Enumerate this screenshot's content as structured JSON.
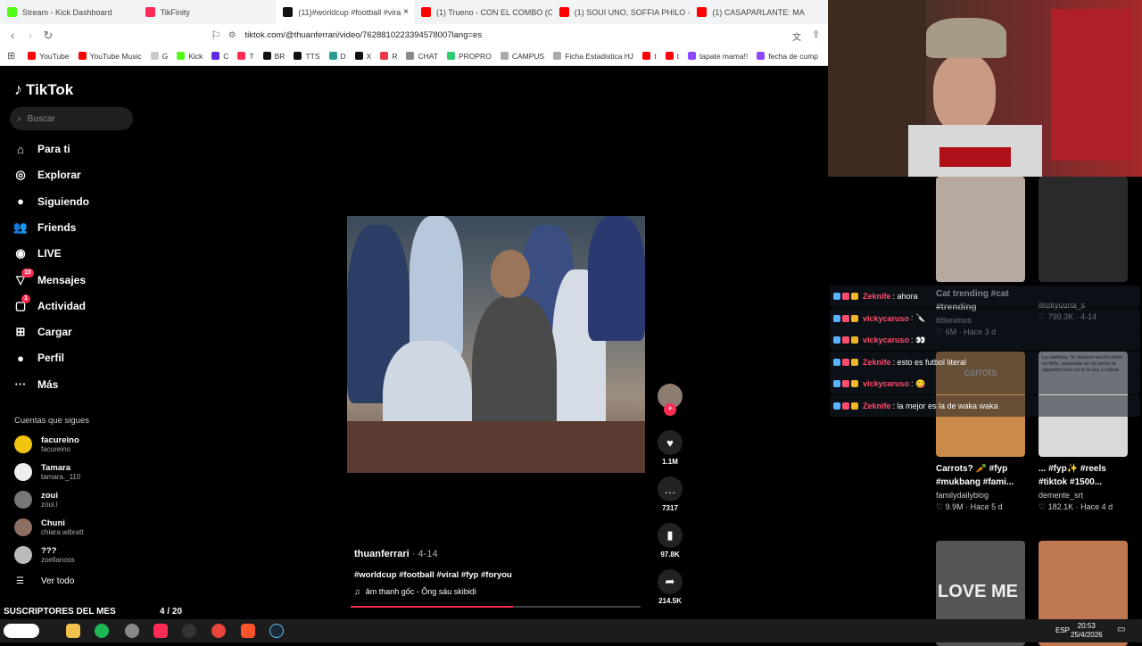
{
  "tabs": [
    {
      "label": "Stream - Kick Dashboard",
      "color": "#53fc18"
    },
    {
      "label": "TikFinity",
      "color": "#fe2c55"
    },
    {
      "label": "(11)#worldcup #football #vira",
      "color": "#111111",
      "active": true
    },
    {
      "label": "(1) Trueno - CON EL COMBO (Officia",
      "color": "#ff0000"
    },
    {
      "label": "(1) SOUI UNO, SOFFIA PHILO - NOS",
      "color": "#ff0000"
    },
    {
      "label": "(1) CASAPARLANTE: MA",
      "color": "#ff0000"
    }
  ],
  "address": {
    "url": "tiktok.com/@thuanferrari/video/7628810223394578007lang=es"
  },
  "bookmarks": [
    {
      "label": "YouTube",
      "color": "#ff0000"
    },
    {
      "label": "YouTube Music",
      "color": "#ff0000"
    },
    {
      "label": "G",
      "color": "#cccccc"
    },
    {
      "label": "Kick",
      "color": "#53fc18"
    },
    {
      "label": "C",
      "color": "#5b2ee0"
    },
    {
      "label": "T",
      "color": "#fe2c55"
    },
    {
      "label": "BR",
      "color": "#111111"
    },
    {
      "label": "TTS",
      "color": "#111111"
    },
    {
      "label": "D",
      "color": "#2a9d8f"
    },
    {
      "label": "X",
      "color": "#111111"
    },
    {
      "label": "R",
      "color": "#e63946"
    },
    {
      "label": "CHAT",
      "color": "#888888"
    },
    {
      "label": "PROPRO",
      "color": "#2ecc71"
    },
    {
      "label": "CAMPUS",
      "color": "#aaaaaa"
    },
    {
      "label": "Ficha Estadistica HJ",
      "color": "#aaaaaa"
    },
    {
      "label": "t",
      "color": "#ff0000"
    },
    {
      "label": "t",
      "color": "#ff0000"
    },
    {
      "label": "tapate mama!!",
      "color": "#9147ff"
    },
    {
      "label": "fecha de cump",
      "color": "#9147ff"
    }
  ],
  "tiktok": {
    "logo": "TikTok",
    "search_placeholder": "Buscar",
    "nav": [
      {
        "label": "Para ti",
        "icon": "⌂"
      },
      {
        "label": "Explorar",
        "icon": "◎"
      },
      {
        "label": "Siguiendo",
        "icon": "●"
      },
      {
        "label": "Friends",
        "icon": "👥"
      },
      {
        "label": "LIVE",
        "icon": "◉"
      },
      {
        "label": "Mensajes",
        "icon": "▽",
        "badge": "10"
      },
      {
        "label": "Actividad",
        "icon": "▢",
        "badge": "1"
      },
      {
        "label": "Cargar",
        "icon": "⊞"
      },
      {
        "label": "Perfil",
        "icon": "●"
      },
      {
        "label": "Más",
        "icon": "···"
      }
    ],
    "following_title": "Cuentas que sigues",
    "following": [
      {
        "name": "facureino",
        "handle": "facureino",
        "color": "#f1c40f"
      },
      {
        "name": "Tamara",
        "handle": "tamara._110",
        "color": "#eeeeee"
      },
      {
        "name": "zoui",
        "handle": "zoui.l",
        "color": "#777777"
      },
      {
        "name": "Chuni",
        "handle": "chiara.wibratt",
        "color": "#8d6e63"
      },
      {
        "name": "???",
        "handle": "zoellanoss",
        "color": "#bbbbbb"
      }
    ],
    "see_all": "Ver todo",
    "video": {
      "author": "thuanferrari",
      "date": "4-14",
      "hashtags": "#worldcup #football #viral #fyp #foryou",
      "music": "âm thanh gốc - Ông sáu skibidi",
      "likes": "1.1M",
      "comments": "7317",
      "saves": "97.8K",
      "shares": "214.5K",
      "progress": 0.56
    }
  },
  "chat": [
    {
      "user": "Zeknife",
      "text": ": ahora",
      "user_color": "#ff4d6d"
    },
    {
      "user": "vickycaruso",
      "text": ": 🔪",
      "user_color": "#ff4d6d"
    },
    {
      "user": "vickycaruso",
      "text": ": 👀",
      "user_color": "#ff4d6d"
    },
    {
      "user": "Zeknife",
      "text": ": esto es futbol literal",
      "user_color": "#ff4d6d"
    },
    {
      "user": "vickycaruso",
      "text": ": 😋",
      "user_color": "#ff4d6d"
    },
    {
      "user": "Zeknife",
      "text": ": la mejor es la de waka waka",
      "user_color": "#ff4d6d"
    }
  ],
  "cards": [
    {
      "title": "Cat trending #cat #trending",
      "user": "littlenimos",
      "stats": "♡ 6M · Hace 3 d",
      "color": "#b7a9a0"
    },
    {
      "title": "",
      "user": "iikokyuuna_s",
      "stats": "♡ 799.3K · 4-14",
      "color": "#2a2a2a"
    },
    {
      "title": "Carrots? 🥕 #fyp #mukbang #fami...",
      "user": "familydailyblog",
      "stats": "♡ 9.9M · Hace 5 d",
      "color": "#c98a4a",
      "overlay": "carrots"
    },
    {
      "title": "... #fyp✨ #reels #tiktok #1500...",
      "user": "demente_srt",
      "stats": "♡ 182.1K · Hace 4 d",
      "color": "#d9d9d9",
      "overlay": "La cariñosa: Te hicieron mucho daño mi Niño, acuéstate en mi pecho la siguiente hora no te la voy a cobrar."
    },
    {
      "title": "",
      "user": "",
      "stats": "",
      "color": "#555555",
      "overlay": "LOVE ME"
    },
    {
      "title": "",
      "user": "",
      "stats": "",
      "color": "#c07850"
    }
  ],
  "subs": {
    "label": "SUSCRIPTORES DEL MES",
    "count": "4 / 20"
  },
  "taskbar": {
    "lang": "ESP",
    "time": "20:53",
    "date": "25/4/2026"
  }
}
